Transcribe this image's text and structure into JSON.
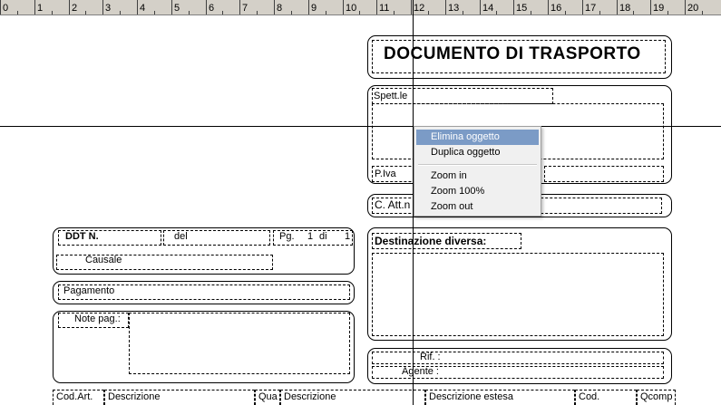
{
  "ruler": {
    "numbers": [
      "0",
      "1",
      "2",
      "3",
      "4",
      "5",
      "6",
      "7",
      "8",
      "9",
      "10",
      "11",
      "12",
      "13",
      "14",
      "15",
      "16",
      "17",
      "18",
      "19",
      "20"
    ]
  },
  "document": {
    "title": "DOCUMENTO DI TRASPORTO",
    "spett_label": "Spett.le",
    "piva_label": "P.Iva",
    "catt_label": "C. Att.n",
    "destinazione_label": "Destinazione diversa:",
    "rif_label": "Rif. :",
    "agente_label": "Agente :",
    "ddt_label": "DDT N.",
    "del_label": "del",
    "pg_label": "Pg.",
    "pg_value": "1",
    "di_label": "di",
    "di_value": "1",
    "causale_label": "Causale",
    "pagamento_label": "Pagamento",
    "note_label": "Note pag.:"
  },
  "context_menu": {
    "items": [
      "Elimina oggetto",
      "Duplica oggetto",
      "Zoom in",
      "Zoom 100%",
      "Zoom out"
    ],
    "selected": "Elimina oggetto",
    "highlight_color": "#7b9bc6"
  },
  "table_header": {
    "columns": [
      "Cod.Art.",
      "Descrizione",
      "Qua",
      "Descrizione",
      "Descrizione estesa",
      "Cod.",
      "Qcomp"
    ]
  }
}
